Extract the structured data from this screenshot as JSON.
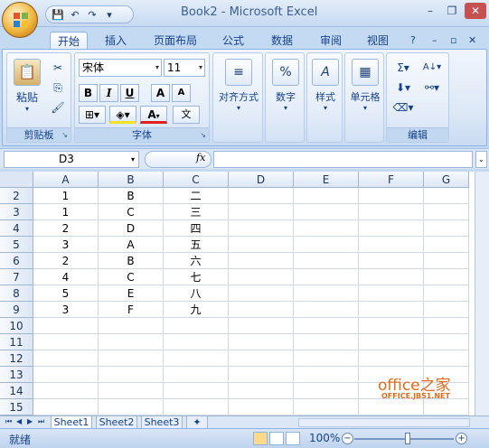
{
  "window": {
    "title": "Book2 - Microsoft Excel",
    "minimize": "–",
    "restore": "❐",
    "close": "✕"
  },
  "qat": {
    "save": "💾",
    "undo": "↶",
    "redo": "↷",
    "more": "▾"
  },
  "tabs": [
    "开始",
    "插入",
    "页面布局",
    "公式",
    "数据",
    "审阅",
    "视图"
  ],
  "ribbon": {
    "clipboard": {
      "label": "剪贴板",
      "paste": "粘贴"
    },
    "font": {
      "label": "字体",
      "name": "宋体",
      "size": "11",
      "bold": "B",
      "italic": "I",
      "underline": "U",
      "grow": "A",
      "shrink": "A",
      "wen": "文"
    },
    "alignment": {
      "label": "对齐方式"
    },
    "number": {
      "label": "数字",
      "icon": "%"
    },
    "styles": {
      "label": "样式"
    },
    "cells": {
      "label": "单元格"
    },
    "editing": {
      "label": "编辑",
      "sum": "Σ",
      "sort": "A↓",
      "find": "🔍"
    }
  },
  "formula_bar": {
    "name_box": "D3",
    "fx": "fx",
    "value": ""
  },
  "grid": {
    "columns": [
      "A",
      "B",
      "C",
      "D",
      "E",
      "F",
      "G"
    ],
    "rows": [
      {
        "num": "2",
        "cells": [
          "1",
          "B",
          "二",
          "",
          "",
          "",
          ""
        ]
      },
      {
        "num": "3",
        "cells": [
          "1",
          "C",
          "三",
          "",
          "",
          "",
          ""
        ]
      },
      {
        "num": "4",
        "cells": [
          "2",
          "D",
          "四",
          "",
          "",
          "",
          ""
        ]
      },
      {
        "num": "5",
        "cells": [
          "3",
          "A",
          "五",
          "",
          "",
          "",
          ""
        ]
      },
      {
        "num": "6",
        "cells": [
          "2",
          "B",
          "六",
          "",
          "",
          "",
          ""
        ]
      },
      {
        "num": "7",
        "cells": [
          "4",
          "C",
          "七",
          "",
          "",
          "",
          ""
        ]
      },
      {
        "num": "8",
        "cells": [
          "5",
          "E",
          "八",
          "",
          "",
          "",
          ""
        ]
      },
      {
        "num": "9",
        "cells": [
          "3",
          "F",
          "九",
          "",
          "",
          "",
          ""
        ]
      },
      {
        "num": "10",
        "cells": [
          "",
          "",
          "",
          "",
          "",
          "",
          ""
        ]
      },
      {
        "num": "11",
        "cells": [
          "",
          "",
          "",
          "",
          "",
          "",
          ""
        ]
      },
      {
        "num": "12",
        "cells": [
          "",
          "",
          "",
          "",
          "",
          "",
          ""
        ]
      },
      {
        "num": "13",
        "cells": [
          "",
          "",
          "",
          "",
          "",
          "",
          ""
        ]
      },
      {
        "num": "14",
        "cells": [
          "",
          "",
          "",
          "",
          "",
          "",
          ""
        ]
      },
      {
        "num": "15",
        "cells": [
          "",
          "",
          "",
          "",
          "",
          "",
          ""
        ]
      }
    ]
  },
  "sheets": [
    "Sheet1",
    "Sheet2",
    "Sheet3"
  ],
  "status": {
    "text": "就绪",
    "zoom": "100%",
    "zoom_out": "−",
    "zoom_in": "+"
  },
  "watermark": {
    "line1": "office之家",
    "line2": "OFFICE.JB51.NET"
  }
}
